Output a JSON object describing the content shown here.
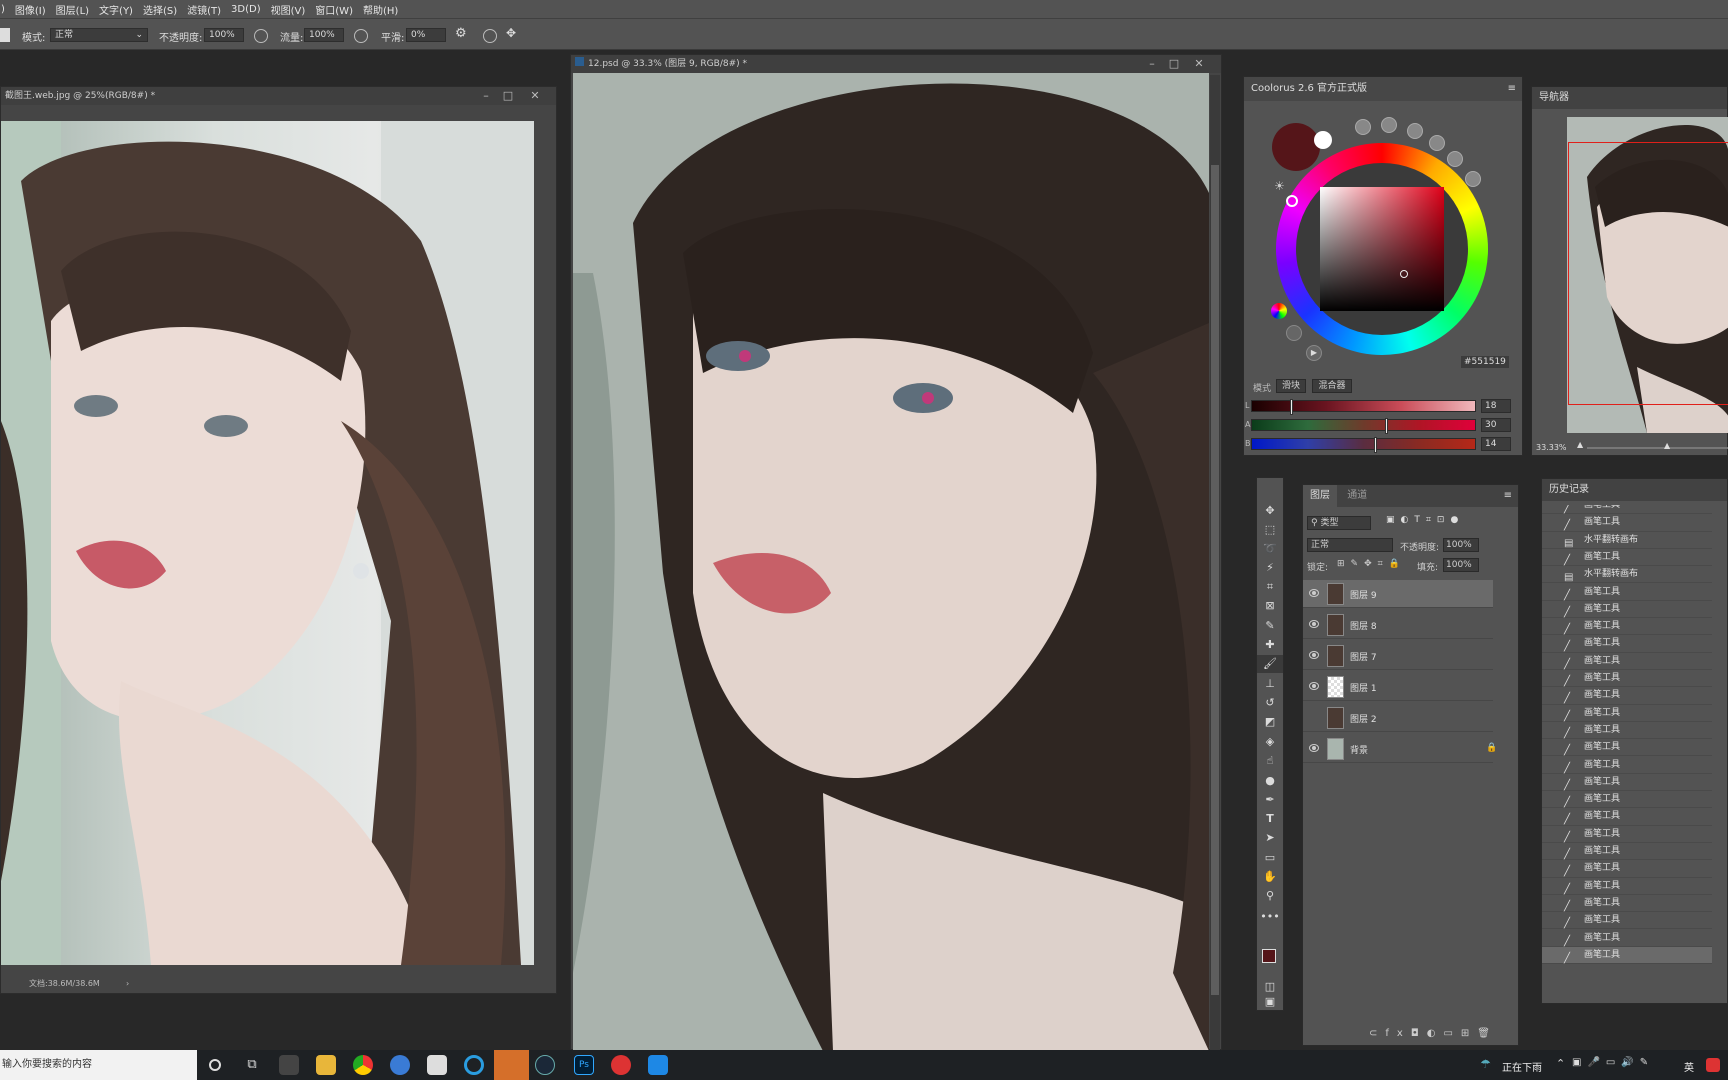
{
  "menubar": {
    "items": [
      "图像(I)",
      "图层(L)",
      "文字(Y)",
      "选择(S)",
      "滤镜(T)",
      "3D(D)",
      "视图(V)",
      "窗口(W)",
      "帮助(H)"
    ]
  },
  "options": {
    "mode_label": "模式:",
    "mode_value": "正常",
    "opacity_label": "不透明度:",
    "opacity_value": "100%",
    "flow_label": "流量:",
    "flow_value": "100%",
    "smooth_label": "平滑:",
    "smooth_value": "0%"
  },
  "doc_ref": {
    "title": "截图王.web.jpg @ 25%(RGB/8#) *",
    "status": "文档:38.6M/38.6M"
  },
  "doc_main": {
    "title": "12.psd @ 33.3% (图层 9, RGB/8#) *"
  },
  "coolorus": {
    "title": "Coolorus 2.6 官方正式版",
    "hex": "#551519",
    "mode_label": "模式",
    "tab_slider": "滑块",
    "tab_mixer": "混合器",
    "sliders": [
      {
        "label": "L",
        "value": "18",
        "pos": 0.17
      },
      {
        "label": "A",
        "value": "30",
        "pos": 0.6
      },
      {
        "label": "B",
        "value": "14",
        "pos": 0.55
      }
    ],
    "colors": {
      "fg": "#551519"
    }
  },
  "navigator": {
    "title": "导航器",
    "zoom": "33.33%"
  },
  "layers": {
    "tab_layers": "图层",
    "tab_channels": "通道",
    "filter_label": "类型",
    "blend_value": "正常",
    "opacity_label": "不透明度:",
    "opacity_value": "100%",
    "lock_label": "锁定:",
    "fill_label": "填充:",
    "fill_value": "100%",
    "items": [
      {
        "name": "图层 9",
        "visible": true,
        "selected": true
      },
      {
        "name": "图层 8",
        "visible": true,
        "selected": false
      },
      {
        "name": "图层 7",
        "visible": true,
        "selected": false
      },
      {
        "name": "图层 1",
        "visible": true,
        "selected": false
      },
      {
        "name": "图层 2",
        "visible": false,
        "selected": false
      },
      {
        "name": "背景",
        "visible": true,
        "selected": false
      }
    ]
  },
  "history": {
    "title": "历史记录",
    "items": [
      "画笔工具",
      "画笔工具",
      "水平翻转画布",
      "画笔工具",
      "水平翻转画布",
      "画笔工具",
      "画笔工具",
      "画笔工具",
      "画笔工具",
      "画笔工具",
      "画笔工具",
      "画笔工具",
      "画笔工具",
      "画笔工具",
      "画笔工具",
      "画笔工具",
      "画笔工具",
      "画笔工具",
      "画笔工具",
      "画笔工具",
      "画笔工具",
      "画笔工具",
      "画笔工具",
      "画笔工具",
      "画笔工具",
      "画笔工具",
      "画笔工具"
    ]
  },
  "taskbar": {
    "search_placeholder": "输入你要搜索的内容",
    "weather": "正在下雨",
    "lang": "英"
  }
}
